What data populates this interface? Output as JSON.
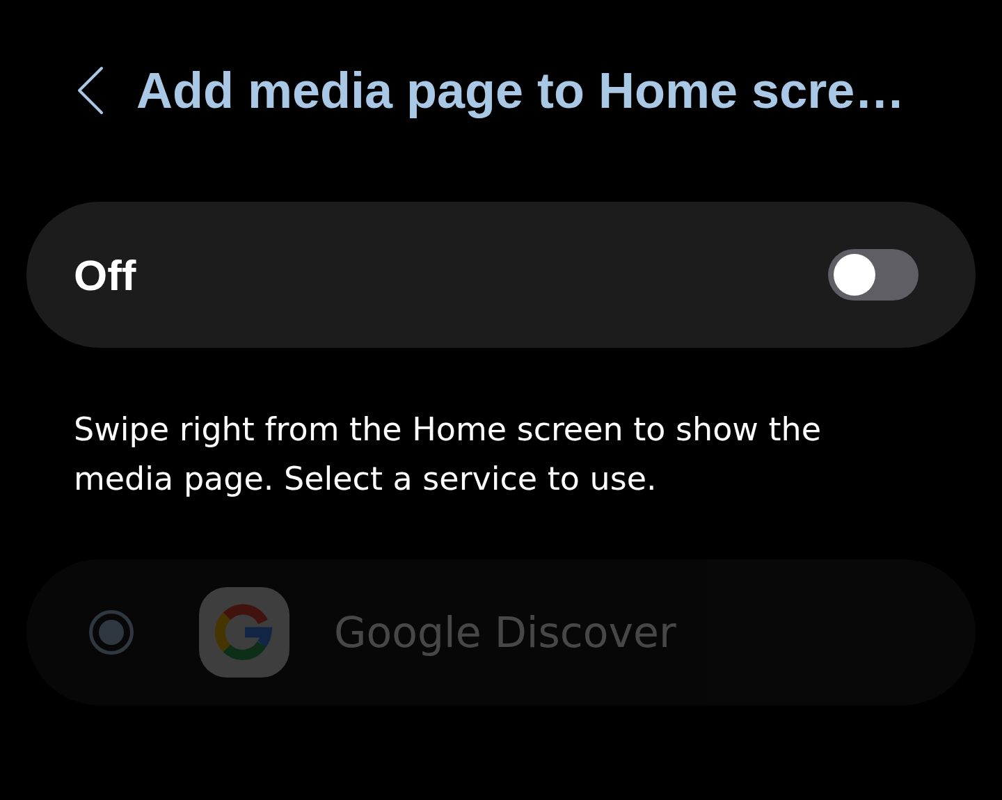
{
  "header": {
    "title": "Add media page to Home scre…"
  },
  "master_switch": {
    "label": "Off",
    "on": false
  },
  "description": "Swipe right from the Home screen to show the media page. Select a service to use.",
  "services": [
    {
      "name": "Google Discover",
      "selected": true,
      "disabled": true
    }
  ]
}
